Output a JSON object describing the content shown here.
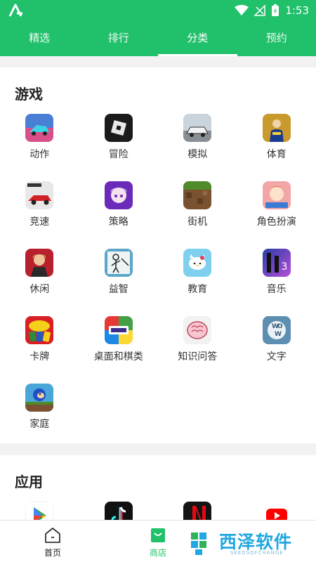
{
  "status_bar": {
    "time": "1:53"
  },
  "tabs": [
    {
      "label": "精选",
      "active": false
    },
    {
      "label": "排行",
      "active": false
    },
    {
      "label": "分类",
      "active": true
    },
    {
      "label": "预约",
      "active": false
    }
  ],
  "games": {
    "title": "游戏",
    "categories": [
      {
        "label": "动作",
        "icon": "racing-car-icon"
      },
      {
        "label": "冒险",
        "icon": "roblox-icon"
      },
      {
        "label": "模拟",
        "icon": "car-simulator-icon"
      },
      {
        "label": "体育",
        "icon": "soccer-player-icon"
      },
      {
        "label": "竞速",
        "icon": "race-car-icon"
      },
      {
        "label": "策略",
        "icon": "anime-character-icon"
      },
      {
        "label": "街机",
        "icon": "minecraft-icon"
      },
      {
        "label": "角色扮演",
        "icon": "cartoon-character-icon"
      },
      {
        "label": "休闲",
        "icon": "fighter-character-icon"
      },
      {
        "label": "益智",
        "icon": "stickman-icon"
      },
      {
        "label": "教育",
        "icon": "hello-kitty-icon"
      },
      {
        "label": "音乐",
        "icon": "piano-tiles-icon"
      },
      {
        "label": "卡牌",
        "icon": "uno-icon"
      },
      {
        "label": "桌面和棋类",
        "icon": "ludo-king-icon"
      },
      {
        "label": "知识问答",
        "icon": "brain-test-icon"
      },
      {
        "label": "文字",
        "icon": "word-game-icon"
      },
      {
        "label": "家庭",
        "icon": "sonic-icon"
      }
    ]
  },
  "apps": {
    "title": "应用",
    "items": [
      {
        "icon": "play-store-icon"
      },
      {
        "icon": "tiktok-icon"
      },
      {
        "icon": "netflix-icon"
      },
      {
        "icon": "youtube-icon"
      }
    ]
  },
  "bottom_nav": [
    {
      "label": "首页",
      "icon": "home-icon",
      "active": false
    },
    {
      "label": "商店",
      "icon": "store-bag-icon",
      "active": true
    }
  ],
  "watermark": {
    "text": "西泽软件",
    "subtext": "SEEDSOFCHANGE"
  },
  "colors": {
    "accent": "#21c16b",
    "background": "#f2f2f2"
  }
}
